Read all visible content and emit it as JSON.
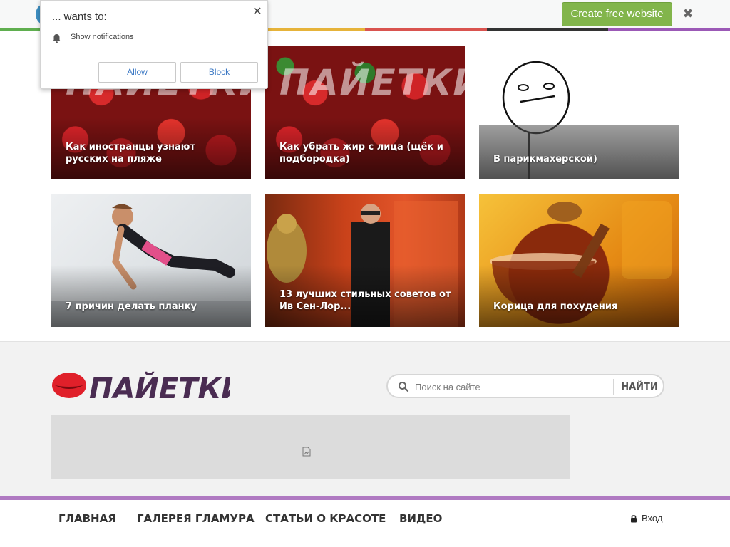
{
  "promo": {
    "create_label": "Create free website",
    "close_glyph": "✖",
    "stripe_colors": [
      "#5fae4f",
      "#3d8fc2",
      "#e6b33a",
      "#d9534f",
      "#333333",
      "#9b59b6"
    ]
  },
  "notification": {
    "title": "... wants to:",
    "close_glyph": "✕",
    "permission": "Show notifications",
    "allow_label": "Allow",
    "block_label": "Block",
    "icon": "bell-icon"
  },
  "articles": [
    {
      "caption": "Как иностранцы узнают русских на пляже",
      "image": "strawberry",
      "overlay": "ПАЙЕТКИ"
    },
    {
      "caption": "Как убрать жир с лица (щёк и подбородка)",
      "image": "strawberry",
      "overlay": "ПАЙЕТКИ"
    },
    {
      "caption": "В парикмахерской)",
      "image": "meme"
    },
    {
      "caption": "7 причин делать планку",
      "image": "plank"
    },
    {
      "caption": "13 лучших стильных советов от Ив Сен-Лор...",
      "image": "fashion"
    },
    {
      "caption": "Корица для похудения",
      "image": "tea"
    }
  ],
  "footer": {
    "logo_text": "ПАЙЕТКИ",
    "search_placeholder": "Поиск на сайте",
    "search_button": "НАЙТИ",
    "ad_icon": "broken-image-icon"
  },
  "nav": {
    "items": [
      "ГЛАВНАЯ",
      "ГАЛЕРЕЯ ГЛАМУРА",
      "СТАТЬИ О КРАСОТЕ",
      "ВИДЕО"
    ],
    "login_label": "Вход",
    "accent": "#b07ac2"
  }
}
